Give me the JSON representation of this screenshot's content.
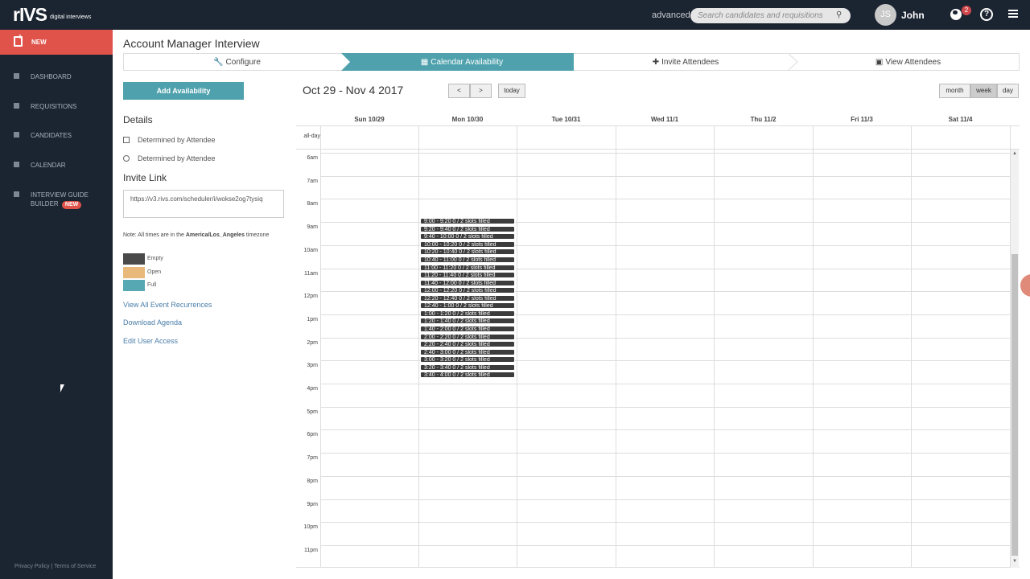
{
  "brand": {
    "logo": "rIVS",
    "tagline": "digital interviews"
  },
  "topbar": {
    "advanced_label": "advanced",
    "search_placeholder": "Search candidates and requisitions",
    "user_initials": "JS",
    "user_name": "John",
    "notification_count": "2",
    "help_glyph": "?"
  },
  "sidebar": {
    "new_label": "NEW",
    "items": [
      {
        "label": "DASHBOARD",
        "icon": "bar-chart-icon"
      },
      {
        "label": "REQUISITIONS",
        "icon": "documents-icon"
      },
      {
        "label": "CANDIDATES",
        "icon": "person-card-icon"
      },
      {
        "label": "CALENDAR",
        "icon": "calendar-icon"
      },
      {
        "label": "INTERVIEW GUIDE",
        "label2": "BUILDER",
        "badge": "NEW",
        "icon": "clipboard-icon"
      }
    ],
    "footer": "Privacy Policy | Terms of Service"
  },
  "page": {
    "title": "Account Manager Interview",
    "steps": [
      "Configure",
      "Calendar Availability",
      "Invite Attendees",
      "View Attendees"
    ],
    "active_step": 1
  },
  "panel": {
    "add_button": "Add Availability",
    "details_heading": "Details",
    "details": [
      "Determined by Attendee",
      "Determined by Attendee"
    ],
    "invite_heading": "Invite Link",
    "invite_url": "https://v3.rivs.com/scheduler/i/wokse2og7tysiq",
    "note_prefix": "Note: All times are in the ",
    "note_tz": "America/Los_Angeles",
    "note_suffix": " timezone",
    "legend": [
      {
        "label": "Empty",
        "color": "#4a4a4a"
      },
      {
        "label": "Open",
        "color": "#e8b97a"
      },
      {
        "label": "Full",
        "color": "#56a8b2"
      }
    ],
    "links": [
      "View All Event Recurrences",
      "Download Agenda",
      "Edit User Access"
    ]
  },
  "calendar": {
    "range": "Oct 29 - Nov 4 2017",
    "prev": "<",
    "next": ">",
    "today": "today",
    "views": [
      "month",
      "week",
      "day"
    ],
    "active_view": "week",
    "allday_label": "all-day",
    "days": [
      "Sun 10/29",
      "Mon 10/30",
      "Tue 10/31",
      "Wed 11/1",
      "Thu 11/2",
      "Fri 11/3",
      "Sat 11/4"
    ],
    "hours": [
      "6am",
      "7am",
      "8am",
      "9am",
      "10am",
      "11am",
      "12pm",
      "1pm",
      "2pm",
      "3pm",
      "4pm",
      "5pm",
      "6pm",
      "7pm",
      "8pm",
      "9pm",
      "10pm",
      "11pm"
    ],
    "event_text": "0 / 2 slots filled",
    "event_times": [
      "9:00 - 9:20",
      "9:20 - 9:40",
      "9:40 - 10:00",
      "10:00 - 10:20",
      "10:20 - 10:40",
      "10:40 - 11:00",
      "11:00 - 11:20",
      "11:20 - 11:40",
      "11:40 - 12:00",
      "12:00 - 12:20",
      "12:20 - 12:40",
      "12:40 - 1:00",
      "1:00 - 1:20",
      "1:20 - 1:40",
      "1:40 - 2:00",
      "2:00 - 2:20",
      "2:20 - 2:40",
      "2:40 - 3:00",
      "3:00 - 3:20",
      "3:20 - 3:40",
      "3:40 - 4:00"
    ]
  }
}
